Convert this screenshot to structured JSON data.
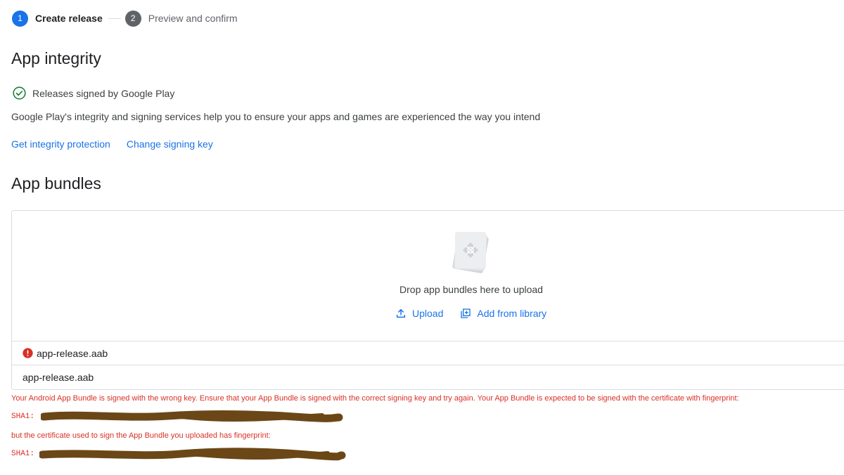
{
  "stepper": {
    "steps": [
      {
        "number": "1",
        "label": "Create release"
      },
      {
        "number": "2",
        "label": "Preview and confirm"
      }
    ]
  },
  "integrity": {
    "title": "App integrity",
    "status": "Releases signed by Google Play",
    "description": "Google Play's integrity and signing services help you to ensure your apps and games are experienced the way you intend",
    "links": [
      "Get integrity protection",
      "Change signing key"
    ]
  },
  "bundles": {
    "title": "App bundles",
    "drop_text": "Drop app bundles here to upload",
    "upload_label": "Upload",
    "library_label": "Add from library",
    "files": [
      {
        "name": "app-release.aab",
        "status": "error"
      },
      {
        "name": "app-release.aab",
        "status": "ok"
      }
    ]
  },
  "error": {
    "message": "Your Android App Bundle is signed with the wrong key. Ensure that your App Bundle is signed with the correct signing key and try again. Your App Bundle is expected to be signed with the certificate with fingerprint:",
    "sha1_label": "SHA1:",
    "message2": "but the certificate used to sign the App Bundle you uploaded has fingerprint:",
    "sha1_label2": "SHA1:"
  },
  "colors": {
    "accent": "#1a73e8",
    "error": "#d93025",
    "success": "#188038",
    "redaction": "#6b4717"
  },
  "icons": [
    "check-circle-icon",
    "upload-icon",
    "add-library-icon",
    "error-icon",
    "app-bundle-illustration"
  ]
}
